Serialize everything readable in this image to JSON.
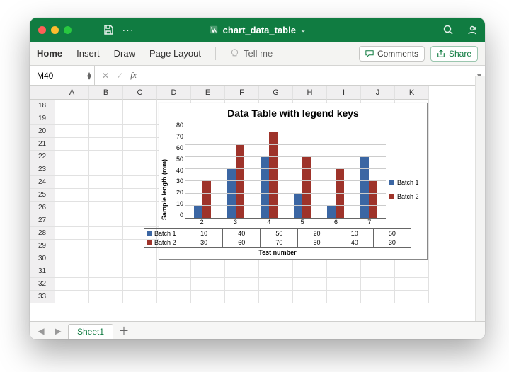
{
  "window": {
    "filename": "chart_data_table"
  },
  "ribbon": {
    "tabs": {
      "home": "Home",
      "insert": "Insert",
      "draw": "Draw",
      "page_layout": "Page Layout"
    },
    "tell_me": "Tell me",
    "comments": "Comments",
    "share": "Share"
  },
  "formula_bar": {
    "name_box": "M40",
    "formula": ""
  },
  "grid": {
    "columns": [
      "A",
      "B",
      "C",
      "D",
      "E",
      "F",
      "G",
      "H",
      "I",
      "J",
      "K"
    ],
    "rows": [
      18,
      19,
      20,
      21,
      22,
      23,
      24,
      25,
      26,
      27,
      28,
      29,
      30,
      31,
      32,
      33
    ]
  },
  "sheet": {
    "active": "Sheet1"
  },
  "legend": {
    "s1": "Batch 1",
    "s2": "Batch 2"
  },
  "chart_data": {
    "type": "bar",
    "title": "Data Table with legend keys",
    "xlabel": "Test number",
    "ylabel": "Sample length (mm)",
    "ylim": [
      0,
      80
    ],
    "yticks": [
      0,
      10,
      20,
      30,
      40,
      50,
      60,
      70,
      80
    ],
    "categories": [
      "2",
      "3",
      "4",
      "5",
      "6",
      "7"
    ],
    "series": [
      {
        "name": "Batch 1",
        "color": "#3b66a3",
        "values": [
          10,
          40,
          50,
          20,
          10,
          50
        ]
      },
      {
        "name": "Batch 2",
        "color": "#9e332a",
        "values": [
          30,
          60,
          70,
          50,
          40,
          30
        ]
      }
    ]
  }
}
